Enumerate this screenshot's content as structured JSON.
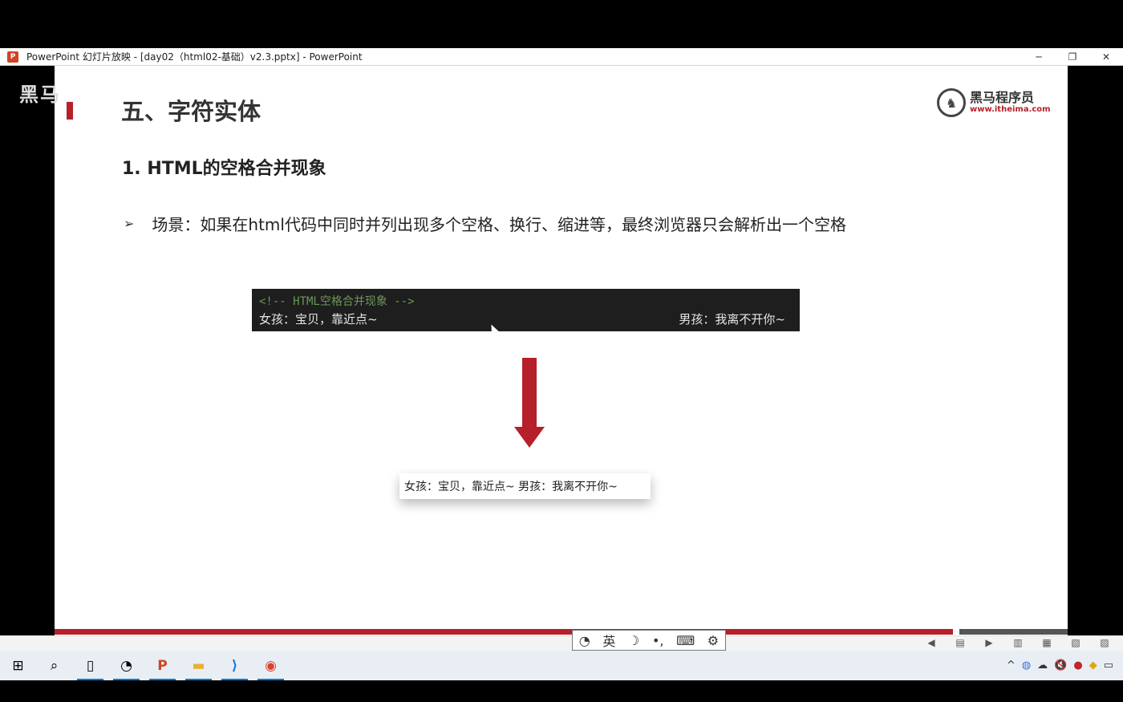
{
  "window": {
    "title": "PowerPoint 幻灯片放映 - [day02（html02-基础）v2.3.pptx] - PowerPoint",
    "icon": "powerpoint-icon",
    "controls": [
      "─",
      "❐",
      "✕"
    ]
  },
  "watermark": "黑马",
  "slide": {
    "title": "五、字符实体",
    "logo_name": "黑马程序员",
    "logo_url": "www.itheima.com",
    "subtitle": "1. HTML的空格合并现象",
    "bullet": "场景：如果在html代码中同时并列出现多个空格、换行、缩进等，最终浏览器只会解析出一个空格",
    "code": {
      "comment": "<!-- HTML空格合并现象 -->",
      "left_text": "女孩：宝贝，靠近点~",
      "right_text": "男孩：我离不开你~"
    },
    "result": "女孩：宝贝，靠近点~ 男孩：我离不开你~",
    "accent_color": "#b5202a"
  },
  "ime": {
    "items": [
      "◔",
      "英",
      "☽",
      "•,",
      "⌨",
      "⚙"
    ]
  },
  "slideshow_controls": [
    "◀",
    "▤",
    "▶",
    "▥",
    "▦",
    "▧",
    "▨"
  ],
  "taskbar": {
    "items": [
      {
        "name": "start-icon",
        "glyph": "⊞"
      },
      {
        "name": "search-icon",
        "glyph": "⌕"
      },
      {
        "name": "file-icon",
        "glyph": "▯"
      },
      {
        "name": "clock-app-icon",
        "glyph": "◔"
      },
      {
        "name": "powerpoint-icon",
        "glyph": "P"
      },
      {
        "name": "folder-icon",
        "glyph": "▬"
      },
      {
        "name": "vscode-icon",
        "glyph": "⟩"
      },
      {
        "name": "chrome-icon",
        "glyph": "◉"
      }
    ],
    "tray": [
      "^",
      "◍",
      "☁",
      "🔇",
      "●",
      "◆",
      "▭"
    ]
  }
}
